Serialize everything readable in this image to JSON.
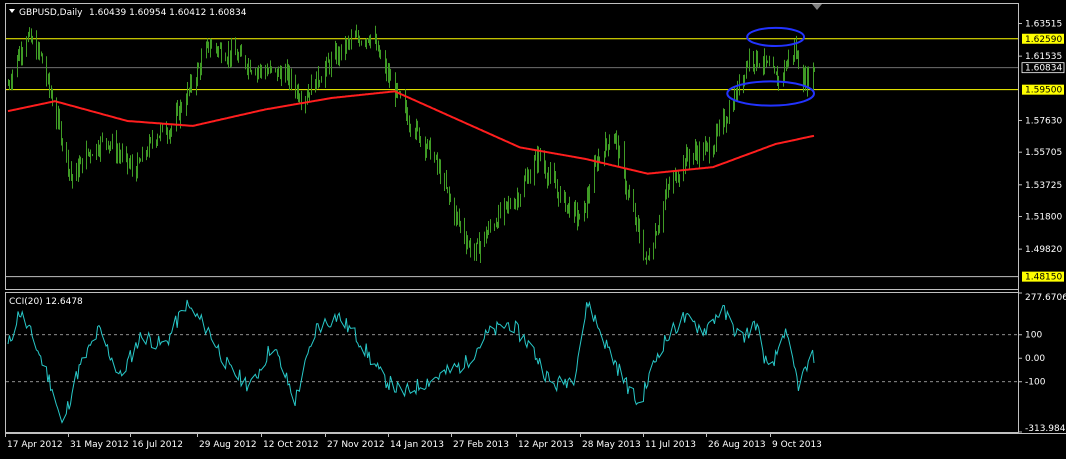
{
  "main_header": {
    "symbol": "GBPUSD,Daily",
    "ohlc": "1.60439 1.60954 1.60412 1.60834"
  },
  "sub_header": {
    "indicator": "CCI(20) 12.6478"
  },
  "colors": {
    "candle": "#3f9b25",
    "ma": "#ff1e1e",
    "cci": "#28c8c8",
    "level_line": "#ffff00",
    "ellipse": "#2233ff",
    "price_box": "#ffff00",
    "text": "#ffffff"
  },
  "chart_data": [
    {
      "type": "bar",
      "title": "GBPUSD,Daily",
      "y_ticks": [
        "1.63515",
        "1.61535",
        "1.57630",
        "1.55705",
        "1.53725",
        "1.51800",
        "1.49820"
      ],
      "ylim": [
        1.474,
        1.647
      ],
      "x_ticks": [
        "17 Apr 2012",
        "31 May 2012",
        "16 Jul 2012",
        "29 Aug 2012",
        "12 Oct 2012",
        "27 Nov 2012",
        "14 Jan 2013",
        "27 Feb 2013",
        "12 Apr 2013",
        "28 May 2013",
        "11 Jul 2013",
        "26 Aug 2013",
        "9 Oct 2013"
      ],
      "levels": [
        {
          "value": 1.6259,
          "label": "1.62590"
        },
        {
          "value": 1.595,
          "label": "1.59500"
        },
        {
          "value": 1.4815,
          "label": "1.48150"
        }
      ],
      "current_price": {
        "value": 1.60834,
        "label": "1.60834"
      },
      "close_anchors": [
        {
          "date": "2012-04-17",
          "close": 1.598
        },
        {
          "date": "2012-04-22",
          "close": 1.612
        },
        {
          "date": "2012-04-30",
          "close": 1.628
        },
        {
          "date": "2012-05-10",
          "close": 1.615
        },
        {
          "date": "2012-05-22",
          "close": 1.575
        },
        {
          "date": "2012-06-01",
          "close": 1.54
        },
        {
          "date": "2012-06-10",
          "close": 1.555
        },
        {
          "date": "2012-06-25",
          "close": 1.565
        },
        {
          "date": "2012-07-15",
          "close": 1.545
        },
        {
          "date": "2012-07-30",
          "close": 1.568
        },
        {
          "date": "2012-08-10",
          "close": 1.572
        },
        {
          "date": "2012-08-25",
          "close": 1.6
        },
        {
          "date": "2012-09-05",
          "close": 1.622
        },
        {
          "date": "2012-09-25",
          "close": 1.615
        },
        {
          "date": "2012-10-10",
          "close": 1.607
        },
        {
          "date": "2012-10-30",
          "close": 1.604
        },
        {
          "date": "2012-11-10",
          "close": 1.59
        },
        {
          "date": "2012-11-30",
          "close": 1.612
        },
        {
          "date": "2012-12-15",
          "close": 1.625
        },
        {
          "date": "2012-12-28",
          "close": 1.628
        },
        {
          "date": "2013-01-08",
          "close": 1.605
        },
        {
          "date": "2013-01-25",
          "close": 1.575
        },
        {
          "date": "2013-02-10",
          "close": 1.555
        },
        {
          "date": "2013-02-25",
          "close": 1.52
        },
        {
          "date": "2013-03-10",
          "close": 1.495
        },
        {
          "date": "2013-03-25",
          "close": 1.515
        },
        {
          "date": "2013-04-10",
          "close": 1.53
        },
        {
          "date": "2013-04-25",
          "close": 1.555
        },
        {
          "date": "2013-05-10",
          "close": 1.53
        },
        {
          "date": "2013-05-25",
          "close": 1.515
        },
        {
          "date": "2013-06-05",
          "close": 1.552
        },
        {
          "date": "2013-06-17",
          "close": 1.569
        },
        {
          "date": "2013-06-25",
          "close": 1.538
        },
        {
          "date": "2013-07-10",
          "close": 1.49
        },
        {
          "date": "2013-07-25",
          "close": 1.535
        },
        {
          "date": "2013-08-08",
          "close": 1.555
        },
        {
          "date": "2013-08-25",
          "close": 1.56
        },
        {
          "date": "2013-09-10",
          "close": 1.59
        },
        {
          "date": "2013-09-20",
          "close": 1.615
        },
        {
          "date": "2013-09-30",
          "close": 1.612
        },
        {
          "date": "2013-10-10",
          "close": 1.6
        },
        {
          "date": "2013-10-22",
          "close": 1.62
        },
        {
          "date": "2013-10-29",
          "close": 1.6
        },
        {
          "date": "2013-11-05",
          "close": 1.608
        }
      ],
      "ma_anchors": [
        {
          "date": "2012-04-17",
          "value": 1.582
        },
        {
          "date": "2012-05-20",
          "value": 1.588
        },
        {
          "date": "2012-07-10",
          "value": 1.576
        },
        {
          "date": "2012-08-25",
          "value": 1.573
        },
        {
          "date": "2012-10-15",
          "value": 1.583
        },
        {
          "date": "2012-12-01",
          "value": 1.59
        },
        {
          "date": "2013-01-14",
          "value": 1.594
        },
        {
          "date": "2013-02-27",
          "value": 1.577
        },
        {
          "date": "2013-04-12",
          "value": 1.56
        },
        {
          "date": "2013-05-28",
          "value": 1.553
        },
        {
          "date": "2013-07-11",
          "value": 1.544
        },
        {
          "date": "2013-08-26",
          "value": 1.548
        },
        {
          "date": "2013-10-09",
          "value": 1.562
        },
        {
          "date": "2013-11-05",
          "value": 1.567
        }
      ],
      "annotations": [
        {
          "shape": "ellipse",
          "date_from": "2013-09-19",
          "date_to": "2013-10-29",
          "price_from": 1.6215,
          "price_to": 1.6325
        },
        {
          "shape": "ellipse",
          "date_from": "2013-09-05",
          "date_to": "2013-11-05",
          "price_from": 1.5853,
          "price_to": 1.6
        }
      ]
    },
    {
      "type": "line",
      "title": "CCI(20) 12.6478",
      "y_ticks": [
        "277.6706",
        "100",
        "0.00",
        "-100",
        "-313.9847"
      ],
      "ylim": [
        -313.9847,
        277.6706
      ],
      "reference_levels": [
        100,
        -100
      ],
      "last_value": 12.6478,
      "cci_anchors": [
        {
          "date": "2012-04-17",
          "value": 50
        },
        {
          "date": "2012-04-25",
          "value": 200
        },
        {
          "date": "2012-05-05",
          "value": 80
        },
        {
          "date": "2012-05-18",
          "value": -120
        },
        {
          "date": "2012-05-25",
          "value": -290
        },
        {
          "date": "2012-06-05",
          "value": -60
        },
        {
          "date": "2012-06-20",
          "value": 120
        },
        {
          "date": "2012-07-05",
          "value": -80
        },
        {
          "date": "2012-07-20",
          "value": 100
        },
        {
          "date": "2012-08-05",
          "value": 50
        },
        {
          "date": "2012-08-20",
          "value": 230
        },
        {
          "date": "2012-09-05",
          "value": 120
        },
        {
          "date": "2012-09-20",
          "value": -50
        },
        {
          "date": "2012-10-05",
          "value": -120
        },
        {
          "date": "2012-10-20",
          "value": 60
        },
        {
          "date": "2012-11-05",
          "value": -180
        },
        {
          "date": "2012-11-20",
          "value": 130
        },
        {
          "date": "2012-12-05",
          "value": 180
        },
        {
          "date": "2012-12-20",
          "value": 80
        },
        {
          "date": "2013-01-05",
          "value": -80
        },
        {
          "date": "2013-01-20",
          "value": -150
        },
        {
          "date": "2013-02-05",
          "value": -100
        },
        {
          "date": "2013-02-20",
          "value": -60
        },
        {
          "date": "2013-03-05",
          "value": -20
        },
        {
          "date": "2013-03-20",
          "value": 100
        },
        {
          "date": "2013-04-05",
          "value": 150
        },
        {
          "date": "2013-04-20",
          "value": 50
        },
        {
          "date": "2013-05-05",
          "value": -120
        },
        {
          "date": "2013-05-20",
          "value": -80
        },
        {
          "date": "2013-05-30",
          "value": 240
        },
        {
          "date": "2013-06-10",
          "value": 80
        },
        {
          "date": "2013-06-25",
          "value": -100
        },
        {
          "date": "2013-07-05",
          "value": -200
        },
        {
          "date": "2013-07-20",
          "value": 50
        },
        {
          "date": "2013-08-05",
          "value": 170
        },
        {
          "date": "2013-08-20",
          "value": 120
        },
        {
          "date": "2013-09-01",
          "value": 210
        },
        {
          "date": "2013-09-15",
          "value": 80
        },
        {
          "date": "2013-09-25",
          "value": 150
        },
        {
          "date": "2013-10-05",
          "value": -80
        },
        {
          "date": "2013-10-15",
          "value": 120
        },
        {
          "date": "2013-10-25",
          "value": -110
        },
        {
          "date": "2013-11-05",
          "value": 12.6478
        }
      ]
    }
  ]
}
